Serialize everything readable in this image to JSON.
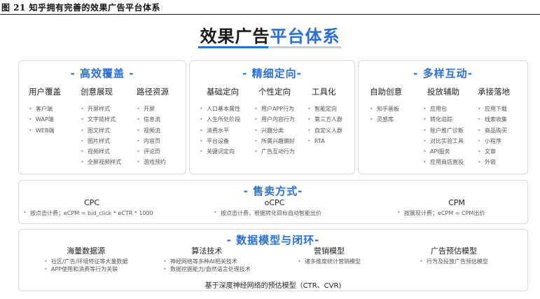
{
  "figure_caption": "图 21 知乎拥有完善的效果广告平台体系",
  "title": {
    "part1": "效果广告",
    "part2": "平台体系"
  },
  "colors": {
    "accent": "#2a6fd6",
    "border": "#d6dae2",
    "bar_gray": "#c9ced8"
  },
  "sections": [
    {
      "title": "- 高效覆盖 -",
      "columns": [
        {
          "header": "用户覆盖",
          "items": [
            "客户端",
            "WAP端",
            "WEB端"
          ]
        },
        {
          "header": "创意展现",
          "items": [
            "开屏样式",
            "文字链样式",
            "图文样式",
            "图片样式",
            "视频样式",
            "全屏视频样式"
          ]
        },
        {
          "header": "路径资源",
          "items": [
            "开屏",
            "信息流",
            "视频流",
            "内容页",
            "评论页",
            "游戏预约"
          ]
        }
      ]
    },
    {
      "title": "- 精细定向-",
      "columns": [
        {
          "header": "基础定向",
          "items": [
            "人口基本属性",
            "人生所处阶段",
            "消费水平",
            "平台设备",
            "关键词定向"
          ]
        },
        {
          "header": "个性定向",
          "items": [
            "用户APP行为",
            "用户内容行为",
            "兴趣分类",
            "所属兴趣偏好",
            "广告互动行为"
          ]
        },
        {
          "header": "工具化",
          "items": [
            "智能定向",
            "第三方人群",
            "自定义人群",
            "RTA"
          ]
        }
      ]
    },
    {
      "title": "- 多样互动-",
      "columns": [
        {
          "header": "自助创意",
          "items": [
            "知乎画板",
            "灵感库"
          ]
        },
        {
          "header": "投放辅助",
          "items": [
            "应用包",
            "转化追踪",
            "账户推广诊断",
            "对比实验工具",
            "API服务",
            "应用商店直投"
          ]
        },
        {
          "header": "承接落地",
          "items": [
            "应用下载",
            "线索收集",
            "商品购买",
            "小程序",
            "文章",
            "外链"
          ]
        }
      ]
    }
  ],
  "sales": {
    "title": "- 售卖方式-",
    "modes": [
      {
        "name": "CPC",
        "note": "按点击计费；eCPM = bid_click * eCTR * 1000"
      },
      {
        "name": "oCPC",
        "note": "按点击计费，根据转化目标自动智能出价"
      },
      {
        "name": "CPM",
        "note": "按展现计费；eCPM = CPM出价"
      }
    ]
  },
  "data_model": {
    "title": "- 数据模型与闭环-",
    "columns": [
      {
        "header": "海量数据源",
        "items": [
          "社区/广告/环境特征等大量数据",
          "APP使用和消费等行为关联"
        ]
      },
      {
        "header": "算法技术",
        "items": [
          "神经网络等多种AI相关技术",
          "数据挖掘能力/自然语言处理技术"
        ]
      },
      {
        "header": "营销模型",
        "items": [
          "诸多维度统计营销模型"
        ]
      },
      {
        "header": "广告预估模型",
        "items": [
          "行为及投放广告预估模型"
        ]
      }
    ],
    "footer": "基于深度神经网络的预估模型（CTR、CVR)"
  }
}
